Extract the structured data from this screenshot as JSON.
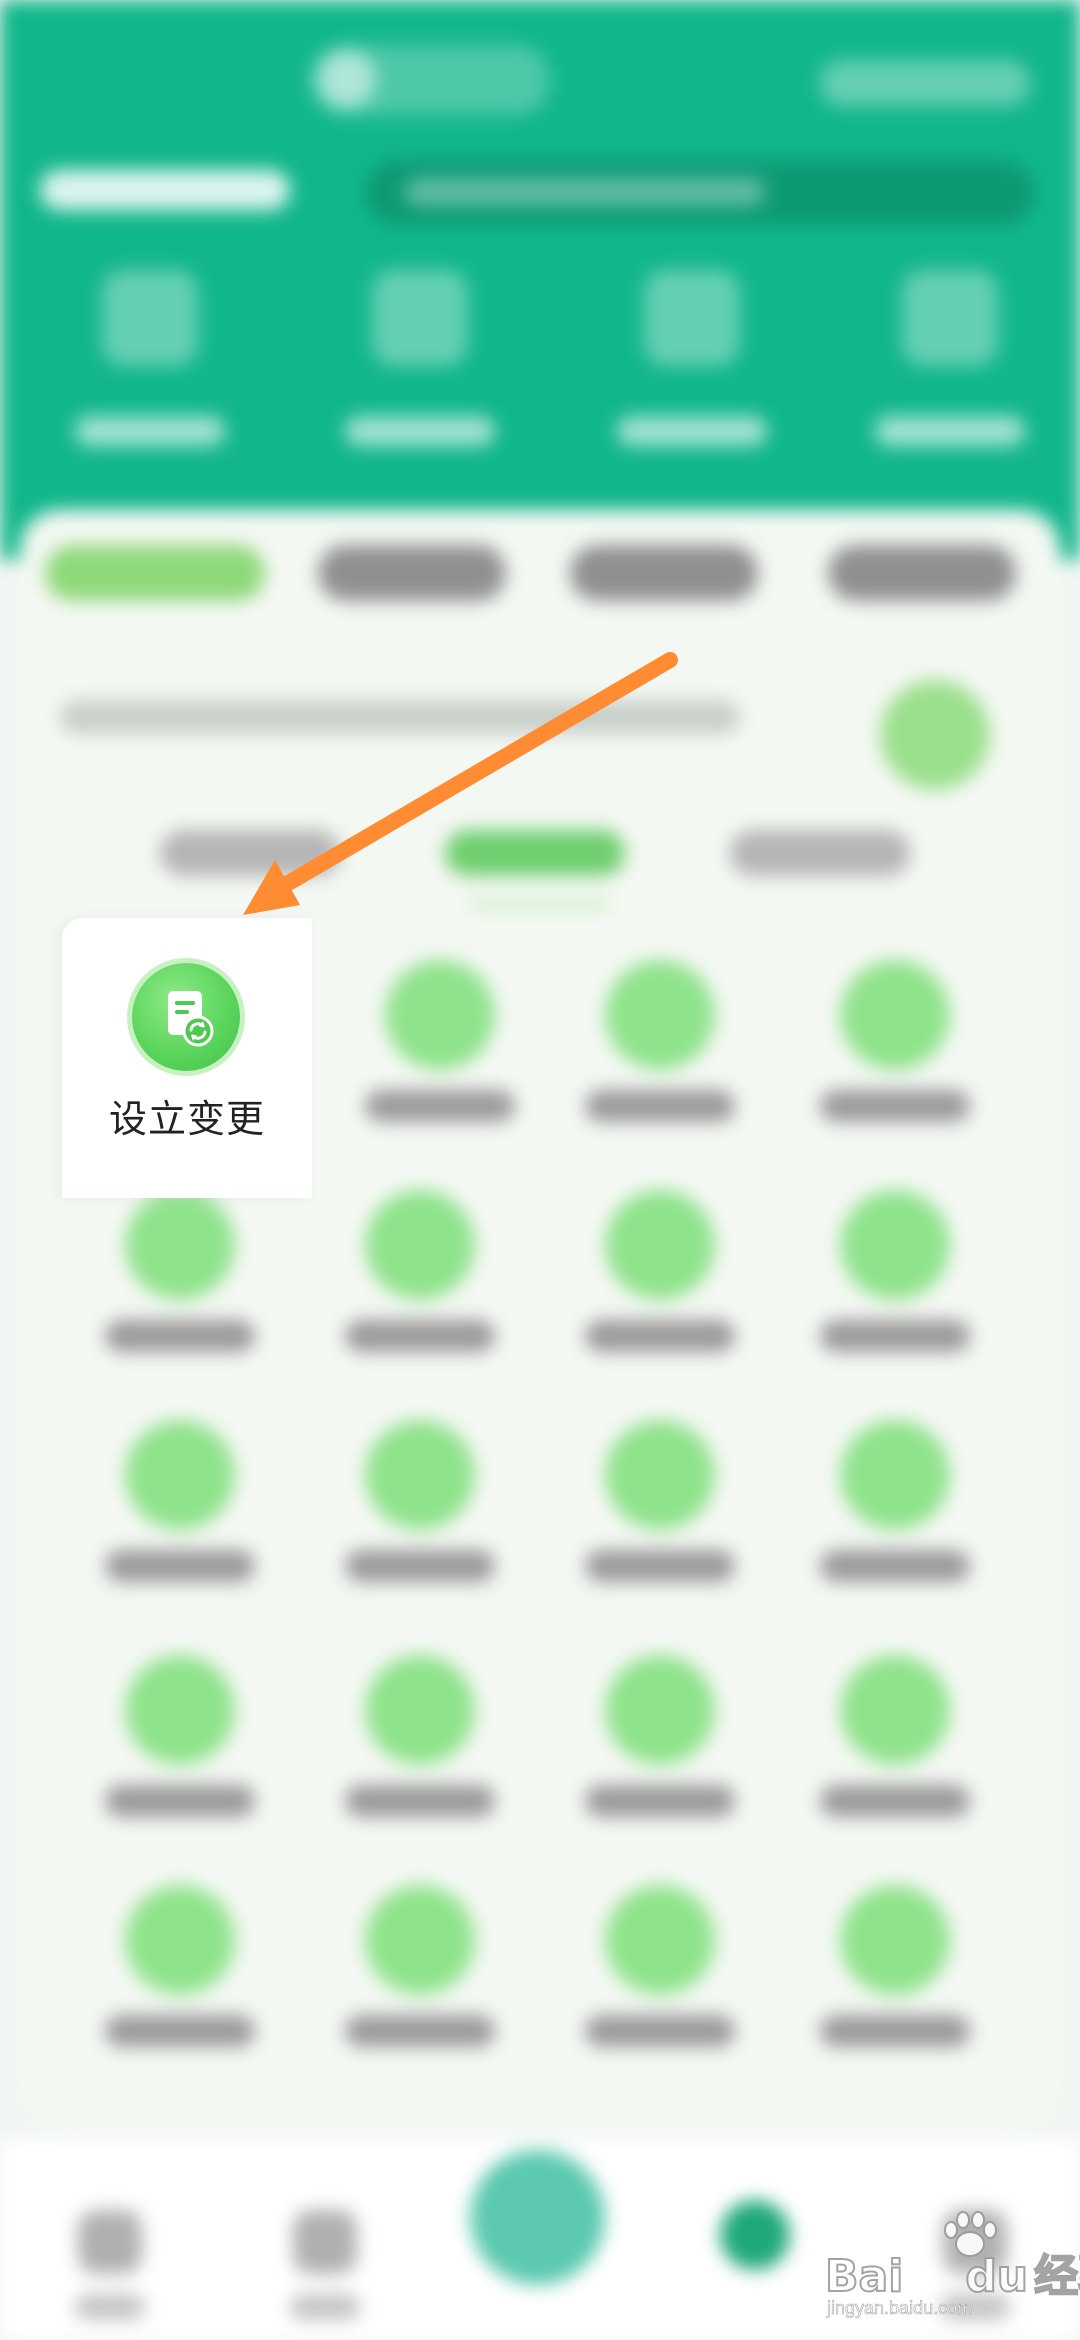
{
  "spotlight": {
    "label": "设立变更",
    "icon": "document-refresh-icon"
  },
  "colors": {
    "header_green": "#12b68c",
    "accent_green": "#5cd55c",
    "arrow_orange": "#ff8c33"
  },
  "annotation": {
    "type": "arrow",
    "points_to": "spotlight"
  },
  "watermark": {
    "brand_left": "Bai",
    "brand_right": "du",
    "brand_cn": "经验",
    "sub": "jingyan.baidu.com"
  }
}
